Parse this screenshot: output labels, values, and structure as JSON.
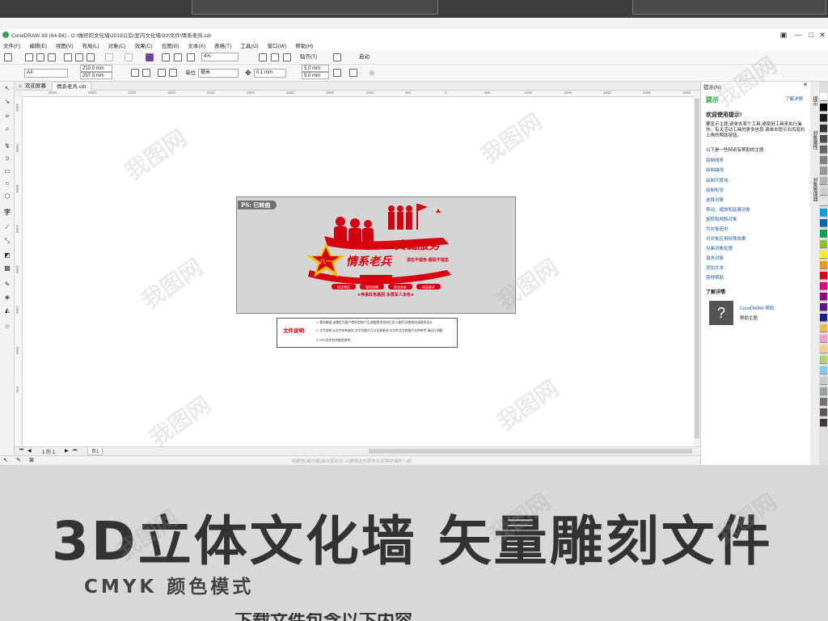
{
  "window": {
    "title": "CorelDRAW X8 (64-Bit) - G:\\做好的文化墙\\2019以后\\室内文化墙\\93\\文件\\情系老兵.cdr",
    "minimize": "—",
    "maximize": "□",
    "close": "✕"
  },
  "menu": [
    "文件(F)",
    "编辑(E)",
    "视图(V)",
    "布局(L)",
    "对象(C)",
    "效果(C)",
    "位图(B)",
    "文本(X)",
    "表格(T)",
    "工具(O)",
    "窗口(W)",
    "帮助(H)"
  ],
  "toolbar": {
    "zoom_value": "4%",
    "snap_label": "贴齐(T)",
    "launch_label": "启动"
  },
  "property_bar": {
    "page_size": "A4",
    "width": "210.0 mm",
    "height": "297.0 mm",
    "units_label": "单位:",
    "units_value": "毫米",
    "nudge": "0.1 mm",
    "dup_x": "5.0 mm",
    "dup_y": "5.0 mm"
  },
  "tabs": [
    {
      "label": "欢迎屏幕"
    },
    {
      "label": "情系老兵.cdr"
    }
  ],
  "rulers": {
    "h_ticks": [
      "5000",
      "4500",
      "4000",
      "3500",
      "3000",
      "2500",
      "2000",
      "1500",
      "1000",
      "500",
      "0",
      "500",
      "1000",
      "1500",
      "2000",
      "2500",
      "3000",
      "3500",
      "4000"
    ],
    "v_ticks": [
      "4000",
      "3500",
      "3000",
      "2500",
      "2000",
      "1500",
      "1000",
      "500"
    ]
  },
  "design": {
    "badge": "PS: 已转曲",
    "headline": "真诚服务",
    "main_title": "情系老兵",
    "motto_small": "退伍不褪色·服役不褪志",
    "tags": [
      "优抚帮扶",
      "服务保障",
      "就业创业",
      "权益维护"
    ],
    "slogan": "★传承红色基因 永葆军人本色★"
  },
  "notes": {
    "label": "文件说明:",
    "lines": [
      "1. 素材精度:该模型为客户需求定制产品,根据需求修改后导入使用,如需修改请联系设计",
      "2. 文字说明:AI文件如有缺失,文字及图片可以任意更改,本文件文字和图片仅供参考,请自行调整",
      "3. EPS文件仅供使用参考。"
    ]
  },
  "page_nav": {
    "counter": "1 的 1",
    "page_tab": "页1"
  },
  "statusbar": {
    "hint": "将颜色(或对象)拖动至此处,以便将这些颜色与文档存储在一起"
  },
  "hints_panel": {
    "header": "提示(N)",
    "title": "提示",
    "learn_more": "了解详情",
    "welcome": "欢迎使用提示!",
    "intro": "要显示主题,请单击某个工具,或使用工具来执行操作。有关活动工具的更多信息,请单击提示泊坞窗右上角的帮助按钮。",
    "topics_intro": "以下是一些特别有帮助的主题:",
    "topics": [
      "绘制线条",
      "绘制曲线",
      "绘制尺度线",
      "绘制形状",
      "选择对象",
      "移动、缩放和延展对象",
      "旋转和倾斜对象",
      "为对象造形",
      "对对象应用特殊效果",
      "勾画对象轮廓",
      "填充对象",
      "添加文本",
      "获得帮助"
    ],
    "more_title": "了解详情",
    "help_line1": "CorelDRAW 帮助",
    "help_line2": "帮助主题"
  },
  "side_tabs": [
    "提示",
    "对象属性",
    "对象管理器"
  ],
  "palette_colors": [
    "#ffffff",
    "#000000",
    "#1a1a1a",
    "#333333",
    "#4d4d4d",
    "#666666",
    "#808080",
    "#999999",
    "#b3b3b3",
    "#cccccc",
    "#e6e6e6",
    "#00a0e9",
    "#0068b7",
    "#00a650",
    "#8fc31f",
    "#fff100",
    "#f39800",
    "#e60012",
    "#e4007f",
    "#920783",
    "#601986",
    "#1d2088",
    "#f8b551",
    "#f19ec2",
    "#facd89",
    "#b3d465",
    "#7ecef4",
    "#c9caca",
    "#9fa0a0",
    "#727171",
    "#595757",
    "#3e3a39"
  ],
  "banner": {
    "title": "3D立体文化墙  矢量雕刻文件",
    "subtitle": "CMYK 颜色模式",
    "cut_text": "下载文件包含以下内容"
  },
  "watermark": "我图网",
  "colors": {
    "accent_red": "#d7000f",
    "gold": "#f2c200",
    "frame_gray": "#d5d5d5",
    "banner_gray": "#d8d8d8",
    "link_blue": "#1a5aa6"
  }
}
